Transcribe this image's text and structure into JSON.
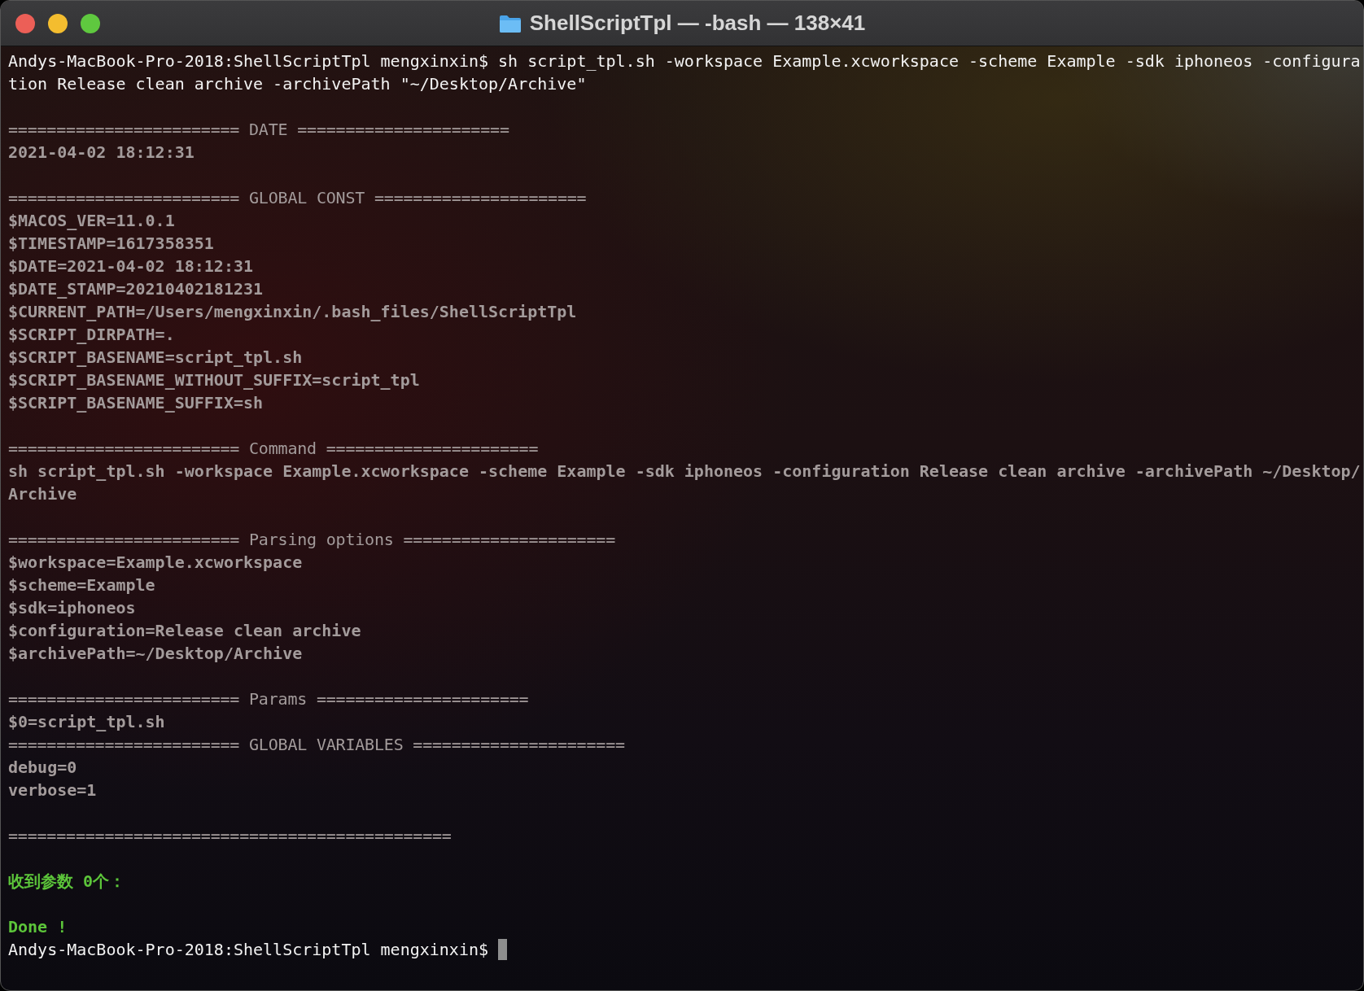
{
  "window": {
    "title": "ShellScriptTpl — -bash — 138×41"
  },
  "lines": [
    {
      "kind": "command",
      "text": "Andys-MacBook-Pro-2018:ShellScriptTpl mengxinxin$ sh script_tpl.sh -workspace Example.xcworkspace -scheme Example -sdk iphoneos -configura"
    },
    {
      "kind": "command",
      "text": "tion Release clean archive -archivePath \"~/Desktop/Archive\""
    },
    {
      "kind": "blank"
    },
    {
      "kind": "separator",
      "text": "======================== DATE ======================"
    },
    {
      "kind": "output",
      "text": "2021-04-02 18:12:31"
    },
    {
      "kind": "blank"
    },
    {
      "kind": "separator",
      "text": "======================== GLOBAL CONST ======================"
    },
    {
      "kind": "output",
      "text": "$MACOS_VER=11.0.1"
    },
    {
      "kind": "output",
      "text": "$TIMESTAMP=1617358351"
    },
    {
      "kind": "output",
      "text": "$DATE=2021-04-02 18:12:31"
    },
    {
      "kind": "output",
      "text": "$DATE_STAMP=20210402181231"
    },
    {
      "kind": "output",
      "text": "$CURRENT_PATH=/Users/mengxinxin/.bash_files/ShellScriptTpl"
    },
    {
      "kind": "output",
      "text": "$SCRIPT_DIRPATH=."
    },
    {
      "kind": "output",
      "text": "$SCRIPT_BASENAME=script_tpl.sh"
    },
    {
      "kind": "output",
      "text": "$SCRIPT_BASENAME_WITHOUT_SUFFIX=script_tpl"
    },
    {
      "kind": "output",
      "text": "$SCRIPT_BASENAME_SUFFIX=sh"
    },
    {
      "kind": "blank"
    },
    {
      "kind": "separator",
      "text": "======================== Command ======================"
    },
    {
      "kind": "output",
      "text": "sh script_tpl.sh -workspace Example.xcworkspace -scheme Example -sdk iphoneos -configuration Release clean archive -archivePath ~/Desktop/"
    },
    {
      "kind": "output",
      "text": "Archive"
    },
    {
      "kind": "blank"
    },
    {
      "kind": "separator",
      "text": "======================== Parsing options ======================"
    },
    {
      "kind": "output",
      "text": "$workspace=Example.xcworkspace"
    },
    {
      "kind": "output",
      "text": "$scheme=Example"
    },
    {
      "kind": "output",
      "text": "$sdk=iphoneos"
    },
    {
      "kind": "output",
      "text": "$configuration=Release clean archive"
    },
    {
      "kind": "output",
      "text": "$archivePath=~/Desktop/Archive"
    },
    {
      "kind": "blank"
    },
    {
      "kind": "separator",
      "text": "======================== Params ======================"
    },
    {
      "kind": "output",
      "text": "$0=script_tpl.sh"
    },
    {
      "kind": "separator",
      "text": "======================== GLOBAL VARIABLES ======================"
    },
    {
      "kind": "output",
      "text": "debug=0"
    },
    {
      "kind": "output",
      "text": "verbose=1"
    },
    {
      "kind": "blank"
    },
    {
      "kind": "separator",
      "text": "=============================================="
    },
    {
      "kind": "blank"
    },
    {
      "kind": "success",
      "text": "收到参数 0个："
    },
    {
      "kind": "blank"
    },
    {
      "kind": "success",
      "text": "Done !"
    },
    {
      "kind": "prompt",
      "text": "Andys-MacBook-Pro-2018:ShellScriptTpl mengxinxin$"
    }
  ]
}
